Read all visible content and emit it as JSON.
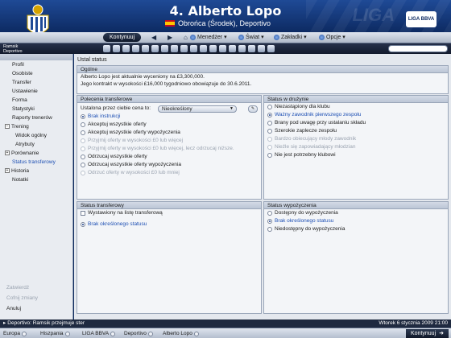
{
  "header": {
    "title": "4. Alberto Lopo",
    "subtitle": "Obrońca (Środek), Deportivo",
    "watermark": "LIGA",
    "league_logo": "LIGA BBVA"
  },
  "navbar": {
    "continue_label": "Kontynuuj",
    "back_icon": "back-arrow-icon",
    "forward_icon": "forward-arrow-icon",
    "home_icon": "home-icon",
    "menus": [
      "Menedżer",
      "Świat",
      "Zakładki",
      "Opcje"
    ]
  },
  "toolbar": {
    "manager_name": "Ramsik",
    "manager_club": "Deportivo"
  },
  "sidebar": {
    "items": [
      {
        "label": "Profil",
        "type": "item"
      },
      {
        "label": "Osobiste",
        "type": "item"
      },
      {
        "label": "Transfer",
        "type": "item"
      },
      {
        "label": "Ustawienie",
        "type": "item"
      },
      {
        "label": "Forma",
        "type": "item"
      },
      {
        "label": "Statystyki",
        "type": "item"
      },
      {
        "label": "Raporty trenerów",
        "type": "item"
      },
      {
        "label": "Trening",
        "type": "toggle",
        "state": "−"
      },
      {
        "label": "Widok ogólny",
        "type": "sub"
      },
      {
        "label": "Atrybuty",
        "type": "sub"
      },
      {
        "label": "Porównanie",
        "type": "toggle",
        "state": "+"
      },
      {
        "label": "Status transferowy",
        "type": "item",
        "active": true
      },
      {
        "label": "Historia",
        "type": "toggle",
        "state": "+"
      },
      {
        "label": "Notatki",
        "type": "item"
      }
    ],
    "bottom": {
      "zatwierdz": "Zatwierdź",
      "cofnij": "Cofnij zmiany",
      "anuluj": "Anuluj"
    }
  },
  "main": {
    "title": "Ustal status",
    "general": {
      "heading": "Ogólne",
      "line1": "Alberto Lopo jest aktualnie wyceniony na £3,300,000.",
      "line2": "Jego kontrakt w wysokości £16,000 tygodniowo obowiązuje do 30.6.2011."
    },
    "transfer_policy": {
      "heading": "Polecenia transferowe",
      "price_label": "Ustalona przez ciebie cena to:",
      "price_value": "Nieokreślony",
      "options": [
        {
          "label": "Brak instrukcji",
          "selected": true
        },
        {
          "label": "Akceptuj wszystkie oferty"
        },
        {
          "label": "Akceptuj wszystkie oferty wypożyczenia"
        },
        {
          "label": "Przyjmij oferty w wysokości £0 lub więcej",
          "disabled": true
        },
        {
          "label": "Przyjmij oferty w wysokości £0 lub więcej, lecz odrzucaj niższe.",
          "disabled": true
        },
        {
          "label": "Odrzucaj wszystkie oferty"
        },
        {
          "label": "Odrzucaj wszystkie oferty wypożyczenia"
        },
        {
          "label": "Odrzuć oferty w wysokości £0 lub mniej",
          "disabled": true
        }
      ]
    },
    "squad_status": {
      "heading": "Status w drużynie",
      "options": [
        {
          "label": "Niezastąpiony dla klubu"
        },
        {
          "label": "Ważny zawodnik pierwszego zespołu",
          "selected": true
        },
        {
          "label": "Brany pod uwagę przy ustalaniu składu"
        },
        {
          "label": "Szerokie zaplecze zespołu"
        },
        {
          "label": "Bardzo obiecujący młody zawodnik",
          "disabled": true
        },
        {
          "label": "Nieźle się zapowiadający młodzian",
          "disabled": true
        },
        {
          "label": "Nie jest potrzebny klubowi"
        }
      ]
    },
    "transfer_status": {
      "heading": "Status transferowy",
      "checkbox_label": "Wystawiony na listę transferową",
      "options": [
        {
          "label": "Brak określonego statusu",
          "selected": true
        }
      ]
    },
    "loan_status": {
      "heading": "Status wypożyczenia",
      "options": [
        {
          "label": "Dostępny do wypożyczenia"
        },
        {
          "label": "Brak określonego statusu",
          "selected": true
        },
        {
          "label": "Niedostępny do wypożyczenia"
        }
      ]
    }
  },
  "statusbar": {
    "message": "Deportivo: Ramsik przejmuje ster",
    "datetime": "Wtorek 6 stycznia 2009 21:00"
  },
  "footer": {
    "crumbs": [
      "Europa",
      "Hiszpania",
      "LIGA BBVA",
      "Deportivo",
      "Alberto Lopo"
    ],
    "continue_label": "Kontynuuj"
  },
  "colors": {
    "header_blue": "#1f4a96",
    "selected_text": "#1d4fb3",
    "disabled_text": "#9aa3b0"
  }
}
